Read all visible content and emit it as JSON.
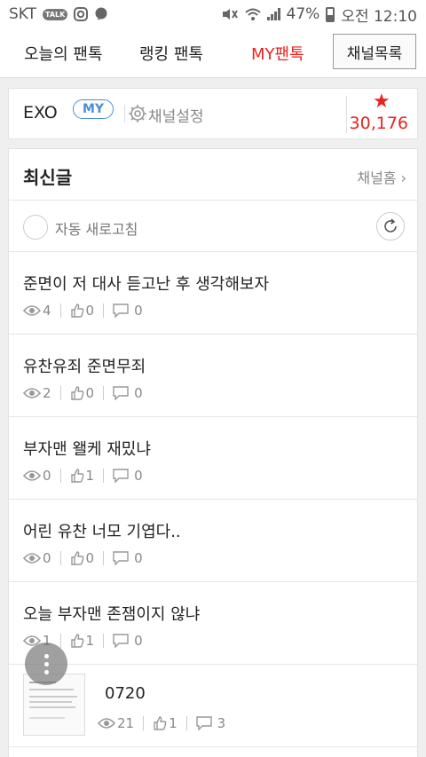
{
  "status_bar": {
    "carrier": "SKT",
    "talk_badge": "TALK",
    "icons": [
      "kakaotalk-icon",
      "instagram-icon",
      "chat-icon",
      "mute-icon",
      "wifi-icon",
      "signal-icon",
      "battery-icon"
    ],
    "battery": "47%",
    "time": "오전 12:10"
  },
  "tabs": {
    "today": "오늘의 팬톡",
    "ranking": "랭킹 팬톡",
    "my": "MY팬톡",
    "channel_list": "채널목록"
  },
  "channel": {
    "name": "EXO",
    "badge": "MY",
    "settings": "채널설정",
    "star_count": "30,176"
  },
  "feed": {
    "title": "최신글",
    "home_link": "채널홈 ›",
    "auto_refresh": "자동 새로고침",
    "posts": [
      {
        "title": "준면이 저 대사 듣고난 후 생각해보자",
        "views": "4",
        "likes": "0",
        "comments": "0"
      },
      {
        "title": "유찬유죄 준면무죄",
        "views": "2",
        "likes": "0",
        "comments": "0"
      },
      {
        "title": "부자맨 왤케 재밌냐",
        "views": "0",
        "likes": "1",
        "comments": "0"
      },
      {
        "title": "어린 유찬 너모 기엽다..",
        "views": "0",
        "likes": "0",
        "comments": "0"
      },
      {
        "title": "오늘 부자맨 존잼이지 않냐",
        "views": "1",
        "likes": "1",
        "comments": "0"
      },
      {
        "title": "0720",
        "views": "21",
        "likes": "1",
        "comments": "3"
      }
    ]
  },
  "colors": {
    "accent": "#e8231f",
    "badge": "#4b8fd6"
  }
}
